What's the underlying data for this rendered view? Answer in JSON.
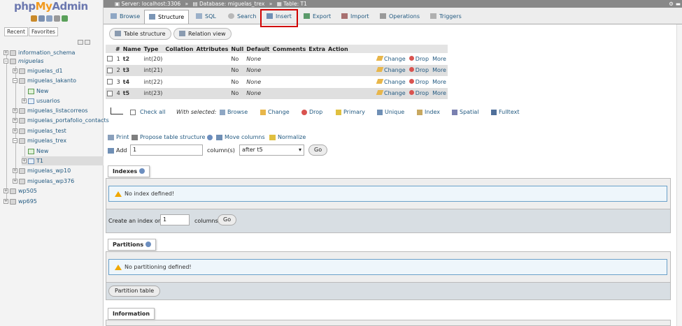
{
  "app": {
    "logo_php": "php",
    "logo_my": "My",
    "logo_admin": "Admin"
  },
  "sidebar": {
    "recent_label": "Recent",
    "favorites_label": "Favorites",
    "tree": [
      {
        "label": "information_schema"
      },
      {
        "label": "miguelas"
      },
      {
        "label": "miguelas_d1"
      },
      {
        "label": "miguelas_lakanto"
      },
      {
        "label": "New"
      },
      {
        "label": "usuarios"
      },
      {
        "label": "miguelas_listacorreos"
      },
      {
        "label": "miguelas_portafolio_contacts"
      },
      {
        "label": "miguelas_test"
      },
      {
        "label": "miguelas_trex"
      },
      {
        "label": "New"
      },
      {
        "label": "T1"
      },
      {
        "label": "miguelas_wp10"
      },
      {
        "label": "miguelas_wp376"
      },
      {
        "label": "wp505"
      },
      {
        "label": "wp695"
      }
    ]
  },
  "breadcrumb": {
    "server": "Server: localhost:3306",
    "database": "Database: miguelas_trex",
    "table": "Table: T1",
    "sep": "»"
  },
  "tabs": [
    {
      "label": "Browse"
    },
    {
      "label": "Structure"
    },
    {
      "label": "SQL"
    },
    {
      "label": "Search"
    },
    {
      "label": "Insert"
    },
    {
      "label": "Export"
    },
    {
      "label": "Import"
    },
    {
      "label": "Operations"
    },
    {
      "label": "Triggers"
    }
  ],
  "subtabs": {
    "table_structure": "Table structure",
    "relation_view": "Relation view"
  },
  "structure": {
    "headers": [
      "#",
      "Name",
      "Type",
      "Collation",
      "Attributes",
      "Null",
      "Default",
      "Comments",
      "Extra",
      "Action"
    ],
    "rows": [
      {
        "num": "1",
        "name": "t2",
        "type": "int(20)",
        "null": "No",
        "default": "None"
      },
      {
        "num": "2",
        "name": "t3",
        "type": "int(21)",
        "null": "No",
        "default": "None"
      },
      {
        "num": "3",
        "name": "t4",
        "type": "int(22)",
        "null": "No",
        "default": "None"
      },
      {
        "num": "4",
        "name": "t5",
        "type": "int(23)",
        "null": "No",
        "default": "None"
      }
    ],
    "actions": {
      "change": "Change",
      "drop": "Drop",
      "more": "More"
    }
  },
  "with_selected": {
    "check_all": "Check all",
    "label": "With selected:",
    "browse": "Browse",
    "change": "Change",
    "drop": "Drop",
    "primary": "Primary",
    "unique": "Unique",
    "index": "Index",
    "spatial": "Spatial",
    "fulltext": "Fulltext"
  },
  "tools": {
    "print": "Print",
    "propose": "Propose table structure",
    "move_columns": "Move columns",
    "normalize": "Normalize"
  },
  "add_column": {
    "add_label": "Add",
    "count_value": "1",
    "columns_label": "column(s)",
    "position_value": "after t5",
    "go": "Go"
  },
  "indexes": {
    "title": "Indexes",
    "notice": "No index defined!",
    "create_label": "Create an index on",
    "create_value": "1",
    "columns_label": "columns",
    "go": "Go"
  },
  "partitions": {
    "title": "Partitions",
    "notice": "No partitioning defined!",
    "button": "Partition table"
  },
  "information": {
    "title": "Information"
  },
  "colors": {
    "accent": "#235a81",
    "highlight": "#d00000",
    "logo_orange": "#f29a1e",
    "logo_blue": "#6c78af"
  }
}
